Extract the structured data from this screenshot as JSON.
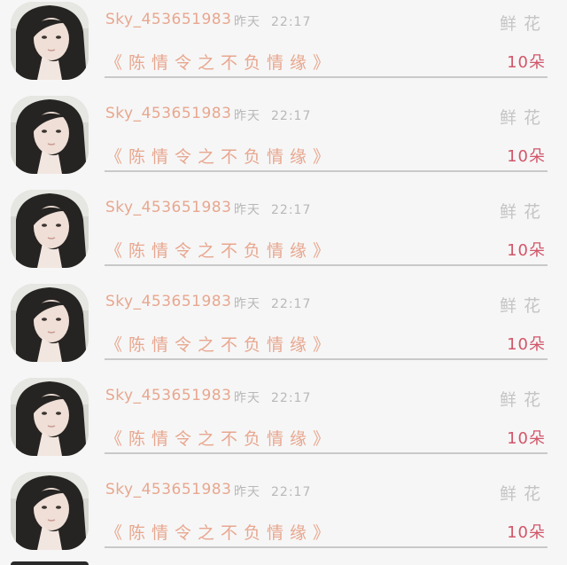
{
  "records": [
    {
      "user": "Sky_453651983",
      "day": "昨天",
      "clock": "22:17",
      "gift": "鲜花",
      "work": "《陈情令之不负情缘》",
      "amount": "10朵"
    },
    {
      "user": "Sky_453651983",
      "day": "昨天",
      "clock": "22:17",
      "gift": "鲜花",
      "work": "《陈情令之不负情缘》",
      "amount": "10朵"
    },
    {
      "user": "Sky_453651983",
      "day": "昨天",
      "clock": "22:17",
      "gift": "鲜花",
      "work": "《陈情令之不负情缘》",
      "amount": "10朵"
    },
    {
      "user": "Sky_453651983",
      "day": "昨天",
      "clock": "22:17",
      "gift": "鲜花",
      "work": "《陈情令之不负情缘》",
      "amount": "10朵"
    },
    {
      "user": "Sky_453651983",
      "day": "昨天",
      "clock": "22:17",
      "gift": "鲜花",
      "work": "《陈情令之不负情缘》",
      "amount": "10朵"
    },
    {
      "user": "Sky_453651983",
      "day": "昨天",
      "clock": "22:17",
      "gift": "鲜花",
      "work": "《陈情令之不负情缘》",
      "amount": "10朵"
    }
  ],
  "colors": {
    "username": "#e8a78f",
    "work_title": "#e8a78f",
    "amount": "#d2566a",
    "muted": "#b8b8b8",
    "divider": "#c9c9c9"
  },
  "icons": {
    "avatar": "user-photo-avatar"
  }
}
